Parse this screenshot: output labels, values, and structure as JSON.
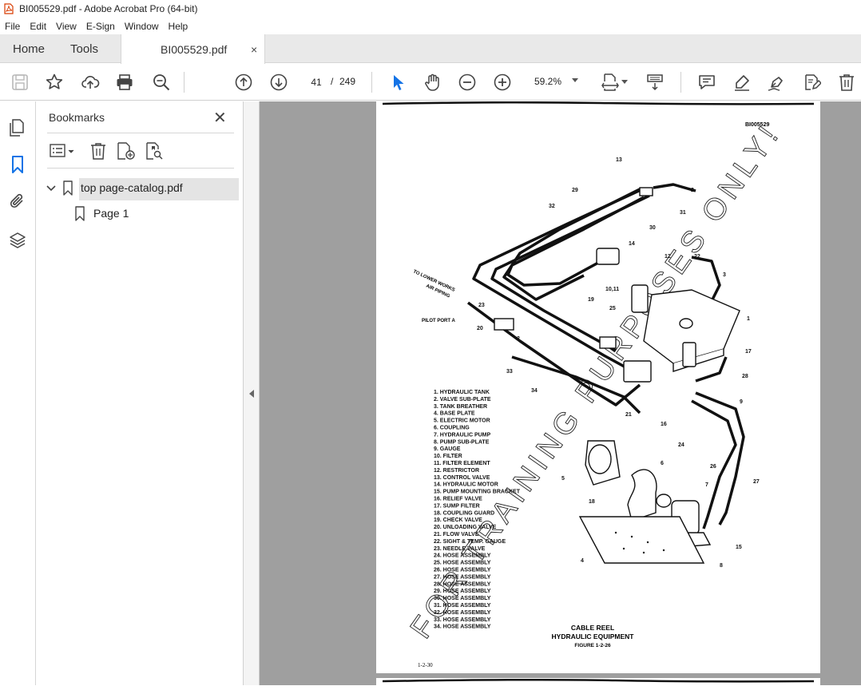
{
  "window": {
    "title": "BI005529.pdf - Adobe Acrobat Pro (64-bit)"
  },
  "menu": [
    "File",
    "Edit",
    "View",
    "E-Sign",
    "Window",
    "Help"
  ],
  "tabs": {
    "home": "Home",
    "tools": "Tools",
    "doc": "BI005529.pdf",
    "close": "×"
  },
  "nav": {
    "page_current": "41",
    "page_sep": "/",
    "page_total": "249",
    "zoom": "59.2%"
  },
  "bookmarks": {
    "title": "Bookmarks",
    "close": "✕",
    "items": [
      {
        "label": "top page-catalog.pdf"
      },
      {
        "label": "Page 1"
      }
    ]
  },
  "document": {
    "doc_id": "BI005529",
    "page_number": "1-2-30",
    "figure_title_1": "CABLE REEL",
    "figure_title_2": "HYDRAULIC EQUIPMENT",
    "figure_caption": "FIGURE 1-2-26",
    "watermark": "FOR TRAINING PURPOSES ONLY!",
    "note_lower_works": "TO LOWER WORKS",
    "note_air_piping": "AIR PIPING",
    "pilot_port": "PILOT PORT A",
    "parts": [
      "1.  HYDRAULIC TANK",
      "2.  VALVE SUB-PLATE",
      "3.  TANK BREATHER",
      "4.  BASE PLATE",
      "5.  ELECTRIC MOTOR",
      "6.  COUPLING",
      "7.  HYDRAULIC PUMP",
      "8.  PUMP SUB-PLATE",
      "9.  GAUGE",
      "10.  FILTER",
      "11.  FILTER ELEMENT",
      "12.  RESTRICTOR",
      "13.  CONTROL VALVE",
      "14.  HYDRAULIC MOTOR",
      "15.  PUMP MOUNTING BRACKET",
      "16.  RELIEF VALVE",
      "17.  SUMP FILTER",
      "18.  COUPLING GUARD",
      "19.  CHECK VALVE",
      "20.  UNLOADING VALVE",
      "21.  FLOW VALVE",
      "22.  SIGHT & TEMP. GAUGE",
      "23.  NEEDLE VALVE",
      "24.  HOSE ASSEMBLY",
      "25.  HOSE ASSEMBLY",
      "26.  HOSE ASSEMBLY",
      "27.  HOSE ASSEMBLY",
      "28.  HOSE ASSEMBLY",
      "29.  HOSE ASSEMBLY",
      "30.  HOSE ASSEMBLY",
      "31.  HOSE ASSEMBLY",
      "32.  HOSE ASSEMBLY",
      "33.  HOSE ASSEMBLY",
      "34.  HOSE ASSEMBLY"
    ],
    "callouts": {
      "c1": "1",
      "c2": "2",
      "c2b": "2",
      "c3": "3",
      "c4": "4",
      "c5": "5",
      "c6": "6",
      "c7": "7",
      "c8": "8",
      "c9": "9",
      "c1011": "10,11",
      "c12": "12",
      "c13": "13",
      "c14": "14",
      "c15": "15",
      "c16": "16",
      "c17": "17",
      "c18": "18",
      "c19": "19",
      "c20": "20",
      "c21": "21",
      "c22": "22",
      "c23": "23",
      "c24": "24",
      "c25": "25",
      "c26": "26",
      "c27": "27",
      "c28": "28",
      "c29": "29",
      "c30": "30",
      "c31": "31",
      "c32": "32",
      "c33": "33",
      "c34": "34"
    }
  },
  "colors": {
    "accent": "#1473e6",
    "pdf_red": "#d83b01"
  }
}
